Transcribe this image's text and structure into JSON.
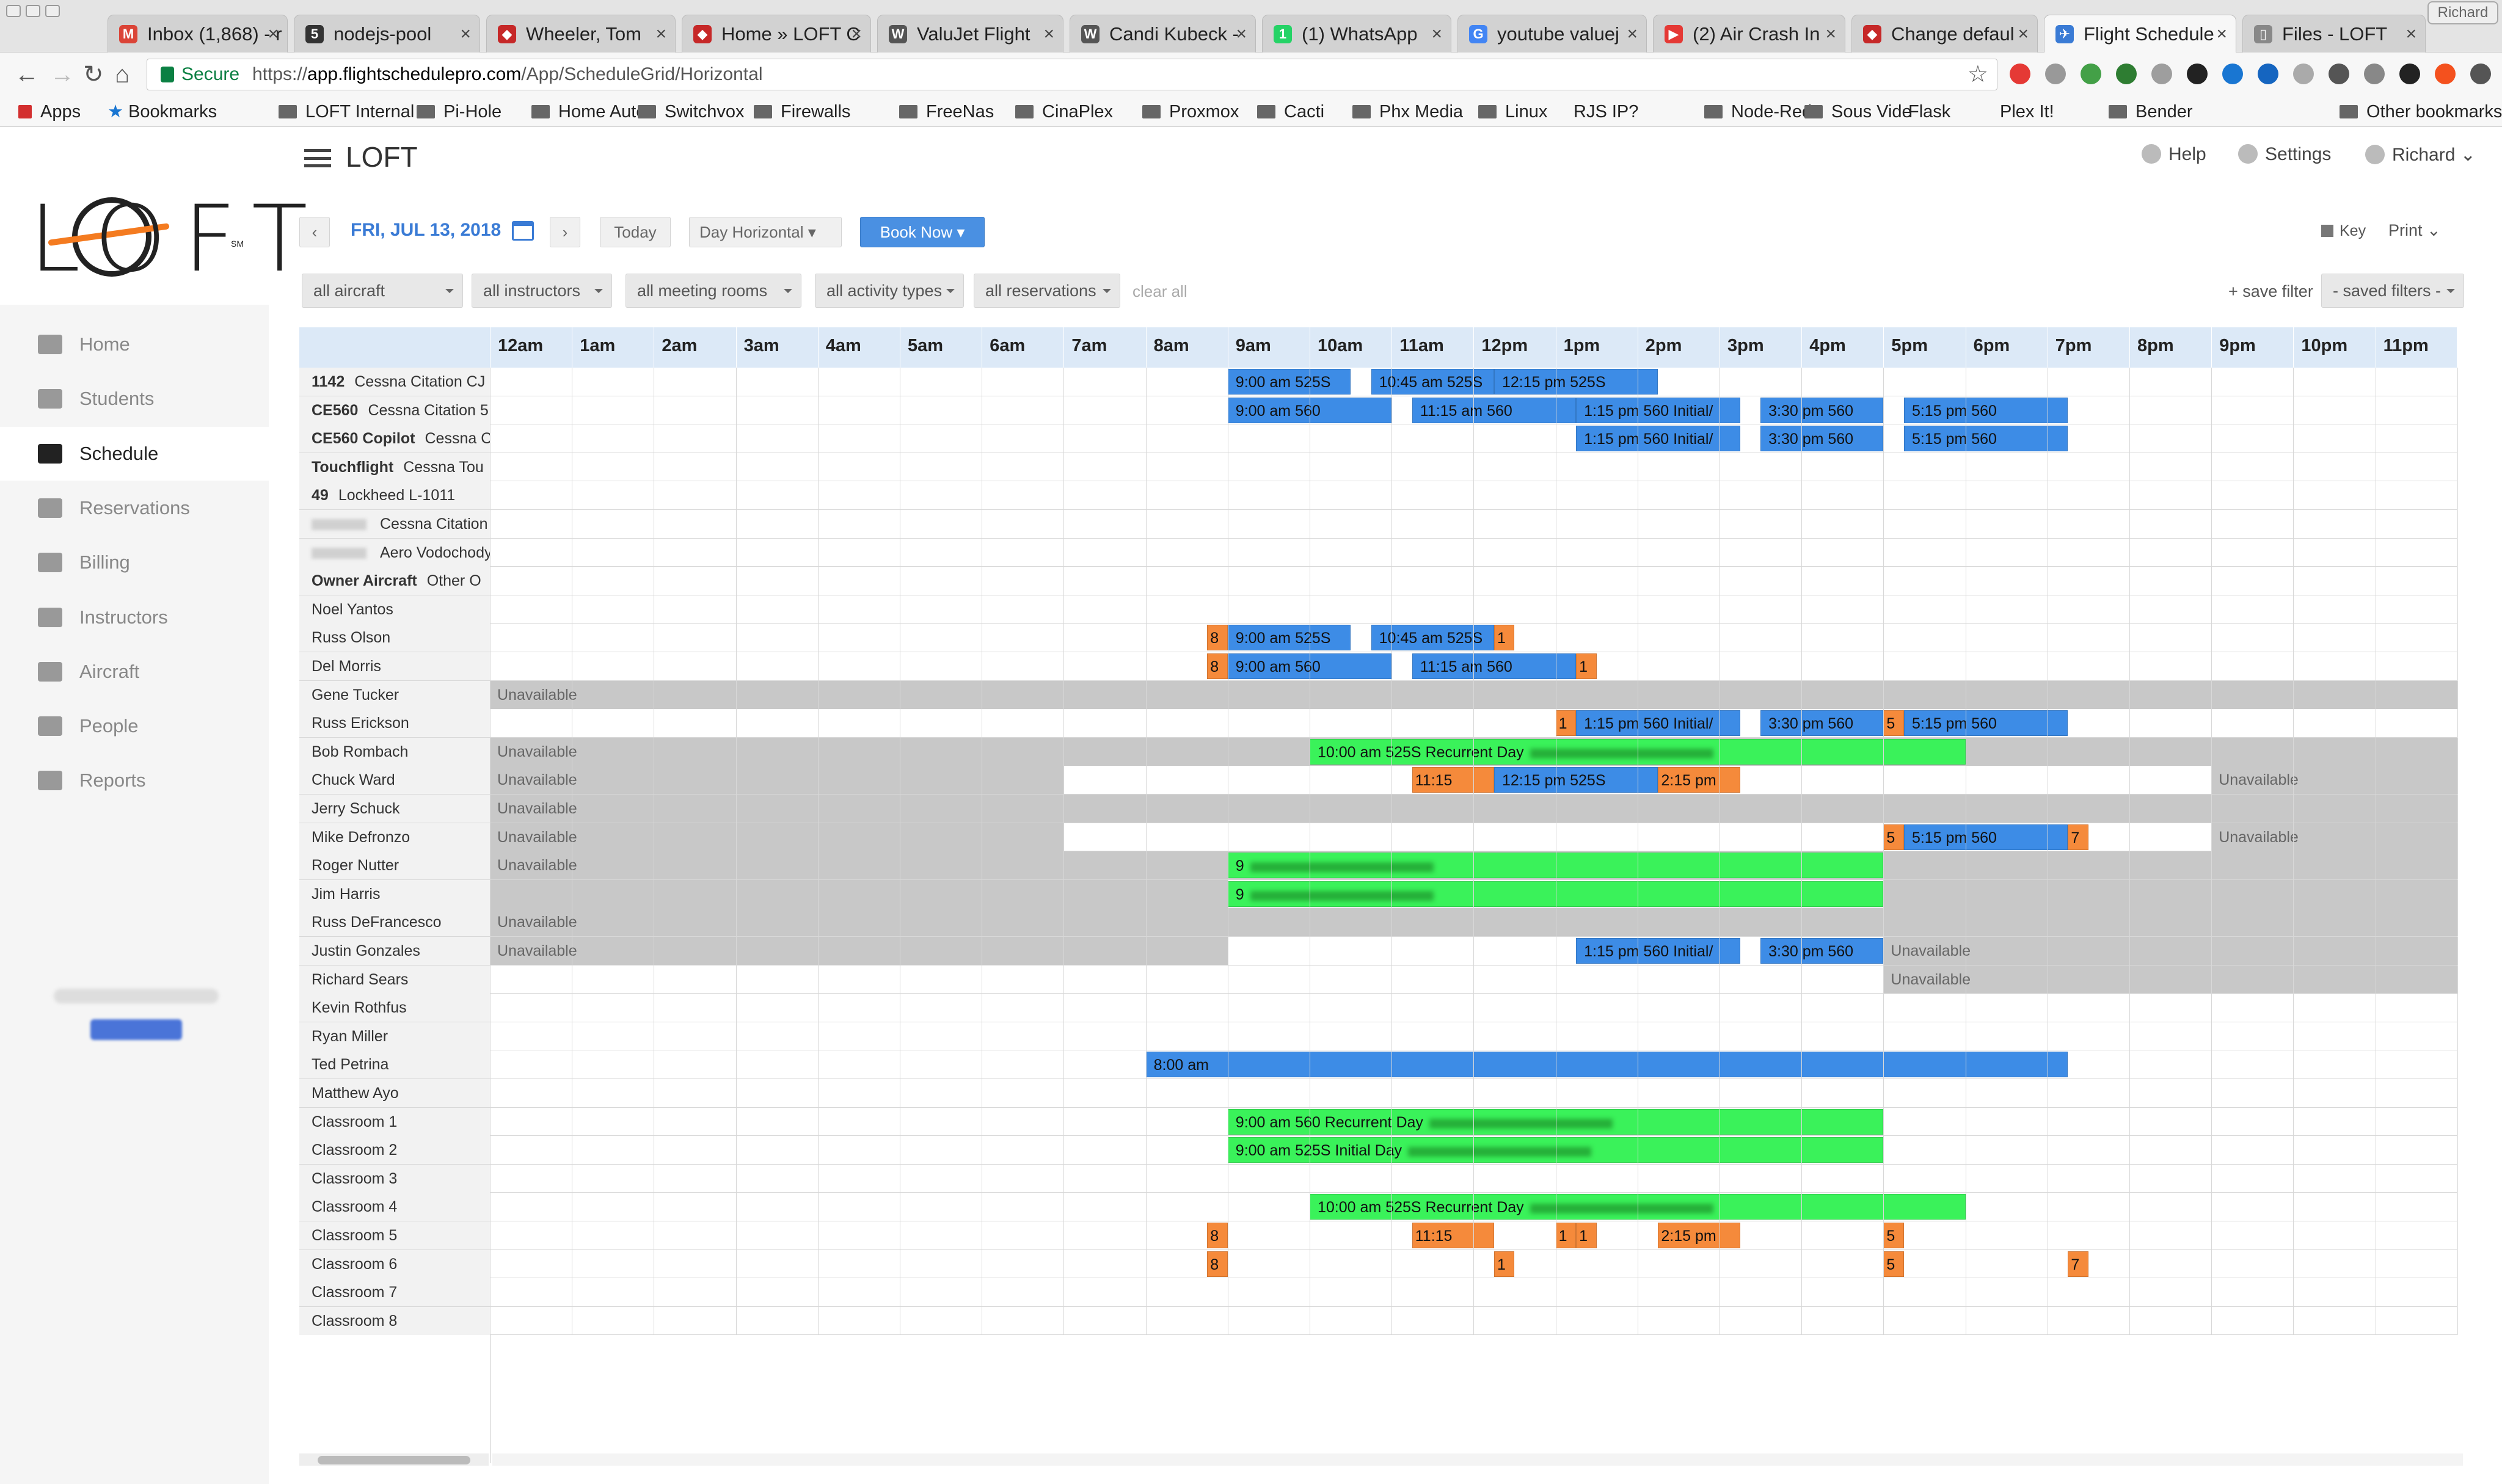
{
  "browser": {
    "tabs": [
      {
        "label": "Inbox (1,868) - r",
        "fav": "M",
        "color": "#db4437"
      },
      {
        "label": "nodejs-pool",
        "fav": "5",
        "color": "#333"
      },
      {
        "label": "Wheeler, Tom",
        "fav": "◆",
        "color": "#c62828"
      },
      {
        "label": "Home » LOFT C",
        "fav": "◆",
        "color": "#c62828"
      },
      {
        "label": "ValuJet Flight",
        "fav": "W",
        "color": "#555"
      },
      {
        "label": "Candi Kubeck -",
        "fav": "W",
        "color": "#555"
      },
      {
        "label": "(1) WhatsApp",
        "fav": "1",
        "color": "#25d366"
      },
      {
        "label": "youtube valuej",
        "fav": "G",
        "color": "#4285f4"
      },
      {
        "label": "(2) Air Crash In",
        "fav": "▶",
        "color": "#e53935"
      },
      {
        "label": "Change defaul",
        "fav": "◆",
        "color": "#c62828"
      },
      {
        "label": "Flight Schedule",
        "fav": "✈",
        "color": "#3a7bd5"
      },
      {
        "label": "Files - LOFT",
        "fav": "▯",
        "color": "#888"
      }
    ],
    "profile_name": "Richard",
    "secure_label": "Secure",
    "url_prefix": "https://",
    "url_host": "app.flightschedulepro.com",
    "url_path": "/App/ScheduleGrid/Horizontal",
    "bookmarks": [
      "Apps",
      "Bookmarks",
      "LOFT Internal",
      "Pi-Hole",
      "Home Auto",
      "Switchvox",
      "Firewalls",
      "FreeNas",
      "CinaPlex",
      "Proxmox",
      "Cacti",
      "Phx Media",
      "Linux",
      "RJS IP?",
      "Node-Red",
      "Sous Vide",
      "Flask",
      "Plex It!",
      "Bender",
      "Other bookmarks"
    ]
  },
  "app": {
    "title": "LOFT",
    "logo_text": "LOFT",
    "logo_mark": "SM",
    "help": "Help",
    "settings": "Settings",
    "user": "Richard",
    "nav": [
      "Home",
      "Students",
      "Schedule",
      "Reservations",
      "Billing",
      "Instructors",
      "Aircraft",
      "People",
      "Reports"
    ],
    "active_nav": "Schedule",
    "date": "FRI, JUL 13, 2018",
    "today": "Today",
    "view": "Day Horizontal",
    "book_now": "Book Now",
    "key": "Key",
    "print": "Print",
    "filters": [
      "all aircraft",
      "all instructors",
      "all meeting rooms",
      "all activity types",
      "all reservations"
    ],
    "clear_all": "clear all",
    "save_filter": "+ save filter",
    "saved_filters": "- saved filters -"
  },
  "schedule": {
    "hours": [
      "12am",
      "1am",
      "2am",
      "3am",
      "4am",
      "5am",
      "6am",
      "7am",
      "8am",
      "9am",
      "10am",
      "11am",
      "12pm",
      "1pm",
      "2pm",
      "3pm",
      "4pm",
      "5pm",
      "6pm",
      "7pm",
      "8pm",
      "9pm",
      "10pm",
      "11pm"
    ],
    "rows": [
      {
        "name": "1142",
        "sub": "Cessna Citation CJ",
        "bold": true
      },
      {
        "name": "CE560",
        "sub": "Cessna Citation 5",
        "bold": true
      },
      {
        "name": "CE560 Copilot",
        "sub": "Cessna C",
        "bold": true
      },
      {
        "name": "Touchflight",
        "sub": "Cessna Tou",
        "bold": true
      },
      {
        "name": "49",
        "sub": "Lockheed L-1011",
        "bold": true
      },
      {
        "name": "",
        "sub": "Cessna Citation",
        "blurred": true
      },
      {
        "name": "",
        "sub": "Aero Vodochody",
        "blurred": true
      },
      {
        "name": "Owner Aircraft",
        "sub": "Other O",
        "bold": true
      },
      {
        "name": "Noel Yantos"
      },
      {
        "name": "Russ Olson"
      },
      {
        "name": "Del Morris"
      },
      {
        "name": "Gene Tucker"
      },
      {
        "name": "Russ Erickson"
      },
      {
        "name": "Bob Rombach"
      },
      {
        "name": "Chuck Ward"
      },
      {
        "name": "Jerry Schuck"
      },
      {
        "name": "Mike Defronzo"
      },
      {
        "name": "Roger Nutter"
      },
      {
        "name": "Jim Harris"
      },
      {
        "name": "Russ DeFrancesco"
      },
      {
        "name": "Justin Gonzales"
      },
      {
        "name": "Richard Sears"
      },
      {
        "name": "Kevin Rothfus"
      },
      {
        "name": "Ryan Miller"
      },
      {
        "name": "Ted Petrina"
      },
      {
        "name": "Matthew Ayo"
      },
      {
        "name": "Classroom 1"
      },
      {
        "name": "Classroom 2"
      },
      {
        "name": "Classroom 3"
      },
      {
        "name": "Classroom 4"
      },
      {
        "name": "Classroom 5"
      },
      {
        "name": "Classroom 6"
      },
      {
        "name": "Classroom 7"
      },
      {
        "name": "Classroom 8"
      }
    ],
    "unavailable_label": "Unavailable",
    "unavailable": [
      {
        "row": 11,
        "start": 0,
        "end": 24,
        "label": true
      },
      {
        "row": 13,
        "start": 0,
        "end": 24,
        "label": true
      },
      {
        "row": 14,
        "start": 0,
        "end": 7,
        "label": true
      },
      {
        "row": 14,
        "start": 21,
        "end": 24,
        "label": true
      },
      {
        "row": 15,
        "start": 0,
        "end": 24,
        "label": true
      },
      {
        "row": 16,
        "start": 0,
        "end": 7,
        "label": true
      },
      {
        "row": 16,
        "start": 21,
        "end": 24,
        "label": true
      },
      {
        "row": 17,
        "start": 0,
        "end": 24,
        "label": true
      },
      {
        "row": 18,
        "start": 0,
        "end": 9,
        "label": false
      },
      {
        "row": 18,
        "start": 17,
        "end": 24,
        "label": false
      },
      {
        "row": 19,
        "start": 0,
        "end": 24,
        "label": true
      },
      {
        "row": 20,
        "start": 0,
        "end": 9,
        "label": true
      },
      {
        "row": 20,
        "start": 17,
        "end": 24,
        "label": true
      },
      {
        "row": 21,
        "start": 17,
        "end": 24,
        "label": true
      }
    ],
    "events": [
      {
        "row": 0,
        "start": 9,
        "end": 10.5,
        "color": "blue",
        "label": "9:00 am 525S"
      },
      {
        "row": 0,
        "start": 10.75,
        "end": 12.25,
        "color": "blue",
        "label": "10:45 am 525S"
      },
      {
        "row": 0,
        "start": 12.25,
        "end": 14.25,
        "color": "blue",
        "label": "12:15 pm 525S"
      },
      {
        "row": 1,
        "start": 9,
        "end": 11,
        "color": "blue",
        "label": "9:00 am 560"
      },
      {
        "row": 1,
        "start": 11.25,
        "end": 13.25,
        "color": "blue",
        "label": "11:15 am 560"
      },
      {
        "row": 1,
        "start": 13.25,
        "end": 15.25,
        "color": "blue",
        "label": "1:15 pm 560 Initial/"
      },
      {
        "row": 1,
        "start": 15.5,
        "end": 17,
        "color": "blue",
        "label": "3:30 pm 560"
      },
      {
        "row": 1,
        "start": 17.25,
        "end": 19.25,
        "color": "blue",
        "label": "5:15 pm 560"
      },
      {
        "row": 2,
        "start": 13.25,
        "end": 15.25,
        "color": "blue",
        "label": "1:15 pm 560 Initial/"
      },
      {
        "row": 2,
        "start": 15.5,
        "end": 17,
        "color": "blue",
        "label": "3:30 pm 560"
      },
      {
        "row": 2,
        "start": 17.25,
        "end": 19.25,
        "color": "blue",
        "label": "5:15 pm 560"
      },
      {
        "row": 9,
        "start": 8.75,
        "end": 9,
        "color": "orange",
        "label": "8"
      },
      {
        "row": 9,
        "start": 9,
        "end": 10.5,
        "color": "blue",
        "label": "9:00 am 525S"
      },
      {
        "row": 9,
        "start": 10.75,
        "end": 12.25,
        "color": "blue",
        "label": "10:45 am 525S"
      },
      {
        "row": 9,
        "start": 12.25,
        "end": 12.5,
        "color": "orange",
        "label": "1"
      },
      {
        "row": 10,
        "start": 8.75,
        "end": 9,
        "color": "orange",
        "label": "8"
      },
      {
        "row": 10,
        "start": 9,
        "end": 11,
        "color": "blue",
        "label": "9:00 am 560"
      },
      {
        "row": 10,
        "start": 11.25,
        "end": 13.25,
        "color": "blue",
        "label": "11:15 am 560"
      },
      {
        "row": 10,
        "start": 13.25,
        "end": 13.5,
        "color": "orange",
        "label": "1"
      },
      {
        "row": 12,
        "start": 13,
        "end": 13.25,
        "color": "orange",
        "label": "1"
      },
      {
        "row": 12,
        "start": 13.25,
        "end": 15.25,
        "color": "blue",
        "label": "1:15 pm 560 Initial/"
      },
      {
        "row": 12,
        "start": 15.5,
        "end": 17,
        "color": "blue",
        "label": "3:30 pm 560"
      },
      {
        "row": 12,
        "start": 17,
        "end": 17.25,
        "color": "orange",
        "label": "5"
      },
      {
        "row": 12,
        "start": 17.25,
        "end": 19.25,
        "color": "blue",
        "label": "5:15 pm 560"
      },
      {
        "row": 13,
        "start": 10,
        "end": 18,
        "color": "green",
        "label": "10:00 am 525S Recurrent Day",
        "blur": true
      },
      {
        "row": 14,
        "start": 11.25,
        "end": 12.25,
        "color": "orange",
        "label": "11:15"
      },
      {
        "row": 14,
        "start": 12.25,
        "end": 14.25,
        "color": "blue",
        "label": "12:15 pm 525S"
      },
      {
        "row": 14,
        "start": 14.25,
        "end": 15.25,
        "color": "orange",
        "label": "2:15 pm"
      },
      {
        "row": 16,
        "start": 17,
        "end": 17.25,
        "color": "orange",
        "label": "5"
      },
      {
        "row": 16,
        "start": 17.25,
        "end": 19.25,
        "color": "blue",
        "label": "5:15 pm 560"
      },
      {
        "row": 16,
        "start": 19.25,
        "end": 19.5,
        "color": "orange",
        "label": "7"
      },
      {
        "row": 17,
        "start": 9,
        "end": 17,
        "color": "green",
        "label": "9",
        "blur": true
      },
      {
        "row": 18,
        "start": 9,
        "end": 17,
        "color": "green",
        "label": "9",
        "blur": true
      },
      {
        "row": 20,
        "start": 13.25,
        "end": 15.25,
        "color": "blue",
        "label": "1:15 pm 560 Initial/"
      },
      {
        "row": 20,
        "start": 15.5,
        "end": 17,
        "color": "blue",
        "label": "3:30 pm 560"
      },
      {
        "row": 24,
        "start": 8,
        "end": 19.25,
        "color": "blue",
        "label": "8:00 am"
      },
      {
        "row": 26,
        "start": 9,
        "end": 17,
        "color": "green",
        "label": "9:00 am 560 Recurrent Day",
        "blur": true
      },
      {
        "row": 27,
        "start": 9,
        "end": 17,
        "color": "green",
        "label": "9:00 am 525S Initial Day",
        "blur": true
      },
      {
        "row": 29,
        "start": 10,
        "end": 18,
        "color": "green",
        "label": "10:00 am 525S Recurrent Day",
        "blur": true
      },
      {
        "row": 30,
        "start": 8.75,
        "end": 9,
        "color": "orange",
        "label": "8"
      },
      {
        "row": 30,
        "start": 11.25,
        "end": 12.25,
        "color": "orange",
        "label": "11:15"
      },
      {
        "row": 30,
        "start": 13,
        "end": 13.25,
        "color": "orange",
        "label": "1"
      },
      {
        "row": 30,
        "start": 13.25,
        "end": 13.5,
        "color": "orange",
        "label": "1"
      },
      {
        "row": 30,
        "start": 14.25,
        "end": 15.25,
        "color": "orange",
        "label": "2:15 pm"
      },
      {
        "row": 30,
        "start": 17,
        "end": 17.25,
        "color": "orange",
        "label": "5"
      },
      {
        "row": 31,
        "start": 8.75,
        "end": 9,
        "color": "orange",
        "label": "8"
      },
      {
        "row": 31,
        "start": 12.25,
        "end": 12.5,
        "color": "orange",
        "label": "1"
      },
      {
        "row": 31,
        "start": 17,
        "end": 17.25,
        "color": "orange",
        "label": "5"
      },
      {
        "row": 31,
        "start": 19.25,
        "end": 19.5,
        "color": "orange",
        "label": "7"
      }
    ]
  }
}
